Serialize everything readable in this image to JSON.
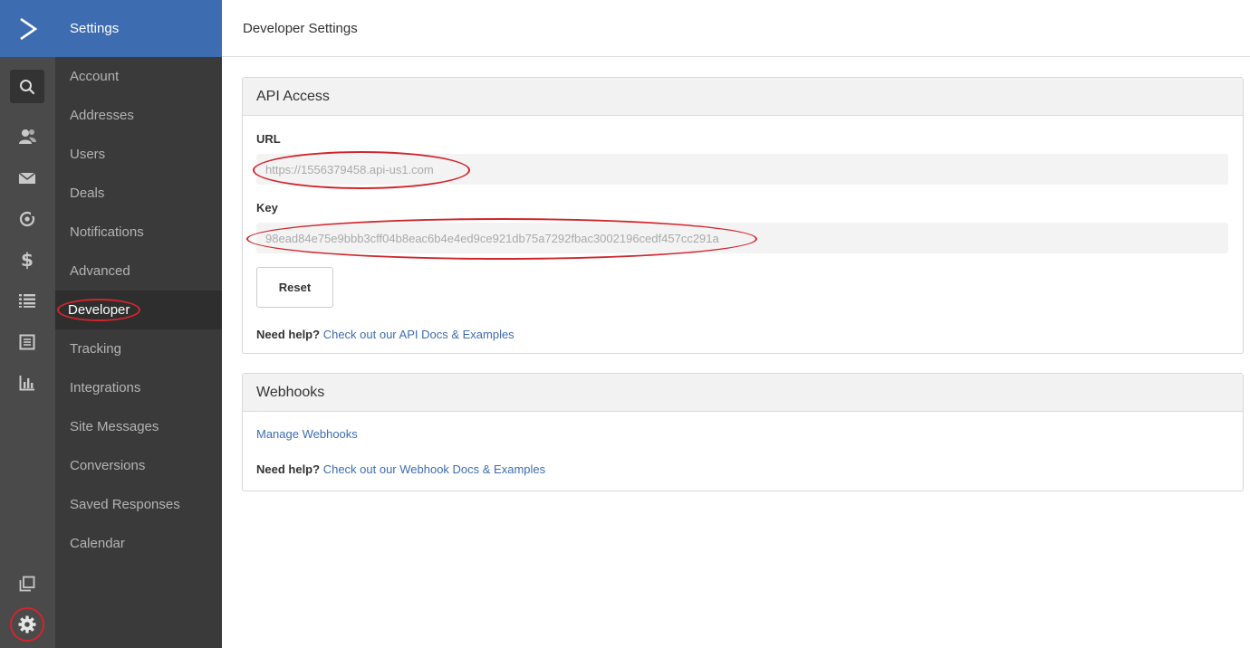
{
  "rail": {
    "logo_glyph": "❯",
    "icons": [
      "search-icon",
      "contacts-icon",
      "campaigns-icon",
      "automations-icon",
      "deals-icon",
      "lists-icon",
      "forms-icon",
      "reports-icon",
      "pages-icon",
      "settings-icon"
    ]
  },
  "menu": {
    "title": "Settings",
    "items": [
      {
        "label": "Account"
      },
      {
        "label": "Addresses"
      },
      {
        "label": "Users"
      },
      {
        "label": "Deals"
      },
      {
        "label": "Notifications"
      },
      {
        "label": "Advanced"
      },
      {
        "label": "Developer",
        "active": true
      },
      {
        "label": "Tracking"
      },
      {
        "label": "Integrations"
      },
      {
        "label": "Site Messages"
      },
      {
        "label": "Conversions"
      },
      {
        "label": "Saved Responses"
      },
      {
        "label": "Calendar"
      }
    ]
  },
  "topbar": {
    "title": "Developer Settings"
  },
  "api": {
    "title": "API Access",
    "url_label": "URL",
    "url_value": "https://1556379458.api-us1.com",
    "key_label": "Key",
    "key_value": "98ead84e75e9bbb3cff04b8eac6b4e4ed9ce921db75a7292fbac3002196cedf457cc291a",
    "reset_label": "Reset",
    "help_prefix": "Need help?",
    "help_link": "Check out our API Docs & Examples"
  },
  "webhooks": {
    "title": "Webhooks",
    "manage_link": "Manage Webhooks",
    "help_prefix": "Need help?",
    "help_link": "Check out our Webhook Docs & Examples"
  },
  "colors": {
    "brand": "#3d6cb0",
    "rail_bg": "#4a4a4a",
    "menu_bg": "#3a3a3a",
    "annotation": "#d0262d"
  }
}
